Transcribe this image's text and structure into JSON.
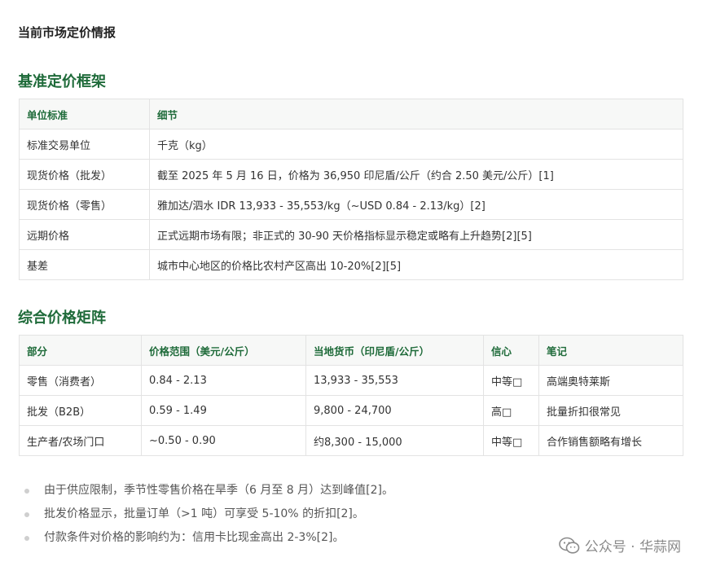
{
  "page_title": "当前市场定价情报",
  "section1": {
    "title": "基准定价框架",
    "headers": [
      "单位标准",
      "细节"
    ],
    "rows": [
      [
        "标准交易单位",
        "千克（kg）"
      ],
      [
        "现货价格（批发）",
        "截至 2025 年 5 月 16 日，价格为 36,950 印尼盾/公斤（约合 2.50 美元/公斤）[1]"
      ],
      [
        "现货价格（零售）",
        "雅加达/泗水 IDR 13,933 - 35,553/kg（~USD 0.84 - 2.13/kg）[2]"
      ],
      [
        "远期价格",
        "正式远期市场有限；非正式的 30-90 天价格指标显示稳定或略有上升趋势[2][5]"
      ],
      [
        "基差",
        "城市中心地区的价格比农村产区高出 10-20%[2][5]"
      ]
    ]
  },
  "section2": {
    "title": "综合价格矩阵",
    "headers": [
      "部分",
      "价格范围（美元/公斤）",
      "当地货币（印尼盾/公斤）",
      "信心",
      "笔记"
    ],
    "rows": [
      [
        "零售（消费者）",
        "0.84 - 2.13",
        "13,933 - 35,553",
        "中等□",
        "高端奥特莱斯"
      ],
      [
        "批发（B2B）",
        "0.59 - 1.49",
        "9,800 - 24,700",
        "高□",
        "批量折扣很常见"
      ],
      [
        "生产者/农场门口",
        "~0.50 - 0.90",
        "约8,300 - 15,000",
        "中等□",
        "合作销售额略有增长"
      ]
    ]
  },
  "notes": [
    "由于供应限制，季节性零售价格在旱季（6 月至 8 月）达到峰值[2]。",
    "批发价格显示，批量订单（>1 吨）可享受 5-10% 的折扣[2]。",
    "付款条件对价格的影响约为：信用卡比现金高出 2-3%[2]。"
  ],
  "watermark": {
    "icon": "wechat-icon",
    "text": "公众号 · 华蒜网"
  }
}
